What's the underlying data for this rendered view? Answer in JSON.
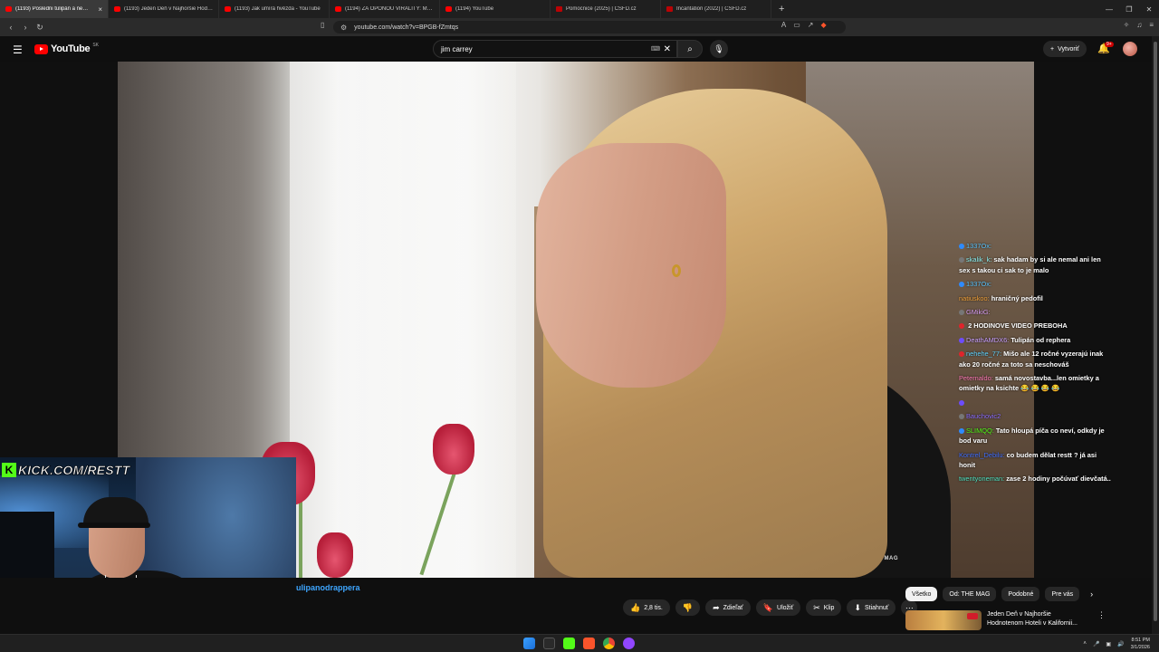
{
  "browser": {
    "tabs": [
      {
        "title": "(1193) Posledni tulipán a ne…",
        "active": true,
        "favicon": "youtube"
      },
      {
        "title": "(1193) Jeden Deň v Najhoršie Hodn…",
        "active": false,
        "favicon": "youtube"
      },
      {
        "title": "(1193) Jak umírá hvězda - YouTube",
        "active": false,
        "favicon": "youtube"
      },
      {
        "title": "(1194) ZA OPONOU VIRALITY: MELI…",
        "active": false,
        "favicon": "youtube"
      },
      {
        "title": "(1194) YouTube",
        "active": false,
        "favicon": "youtube"
      },
      {
        "title": "Pomocnice (2025) | ČSFD.cz",
        "active": false,
        "favicon": "csfd"
      },
      {
        "title": "Incantation (2022) | ČSFD.cz",
        "active": false,
        "favicon": "csfd"
      }
    ],
    "url": "youtube.com/watch?v=BPGB-fZmtqs",
    "badge_count": ""
  },
  "youtube": {
    "logo_text": "YouTube",
    "region": "SK",
    "search_value": "jim carrey",
    "create_label": "Vytvoriť",
    "notif_count": "9+"
  },
  "video": {
    "watermark": "MAG",
    "channel_title": "ulipanodrappera"
  },
  "chat": [
    {
      "user": "1337Ox:",
      "text": "",
      "user_color": "#58c4ff",
      "icon": "#2e8bff"
    },
    {
      "user": "skalik_k:",
      "text": "sak hadam by si ale nemal ani len sex s takou ci sak to je malo",
      "user_color": "#8ef2f2",
      "icon": "#777"
    },
    {
      "user": "1337Ox:",
      "text": "",
      "user_color": "#58c4ff",
      "icon": "#2e8bff"
    },
    {
      "user": "natiuskoo:",
      "text": "hraničný pedofil",
      "user_color": "#f2a23a",
      "icon": ""
    },
    {
      "user": "GMikiG:",
      "text": "",
      "user_color": "#d79cf2",
      "icon": "#777"
    },
    {
      "user": "",
      "text": "2 HODINOVE VIDEO PREBOHA",
      "user_color": "#e0242b",
      "icon": "#e0242b"
    },
    {
      "user": "DeathAMDX6:",
      "text": "Tulipán od rephera",
      "user_color": "#c9a0ff",
      "icon": "#6d4cff"
    },
    {
      "user": "nehehe_77:",
      "text": "Mišo ale 12 ročné vyzerajú inak ako 20 ročné za toto sa neschováš",
      "user_color": "#5fd3ff",
      "icon": "#e0242b"
    },
    {
      "user": "Peternaldo:",
      "text": "samá novostavba...len omietky a omietky na ksichte 😂 😂 😂 😂",
      "user_color": "#ff7ab6",
      "icon": ""
    },
    {
      "user": "",
      "text": "",
      "user_color": "#e0242b",
      "icon": "#6d4cff"
    },
    {
      "user": "Bauchovic2",
      "text": "",
      "user_color": "#8a6cff",
      "icon": "#777"
    },
    {
      "user": "SLIMQQ:",
      "text": "Tato hloupá píča co neví, odkdy je bod varu",
      "user_color": "#53fc18",
      "icon": "#2e8bff"
    },
    {
      "user": "Kontrel_Debilu:",
      "text": "co budem dělat restt ? já asi honit",
      "user_color": "#3e6dff",
      "icon": ""
    },
    {
      "user": "twentyoneman:",
      "text": "zase 2 hodiny počúvať dievčatá..",
      "user_color": "#4fe0c0",
      "icon": ""
    }
  ],
  "overlay": {
    "kick_url": "KICK.COM/RESTT"
  },
  "actions": {
    "like_count": "2,8 tis.",
    "share_label": "Zdieľať",
    "save_label": "Uložiť",
    "clip_label": "Klip",
    "download_label": "Stiahnuť"
  },
  "chips": [
    {
      "label": "Všetko",
      "selected": true
    },
    {
      "label": "Od: THE MAG",
      "selected": false
    },
    {
      "label": "Podobné",
      "selected": false
    },
    {
      "label": "Pre vás",
      "selected": false
    }
  ],
  "recommendation": {
    "title": "Jeden Deň v Najhoršie Hodnotenom Hoteli v Kalifornii..."
  },
  "taskbar": {
    "time": "8:51 PM",
    "date": "3/1/2026"
  },
  "colors": {
    "youtube_red": "#ff0000",
    "kick_green": "#53fc18",
    "link_blue": "#3ea6ff"
  }
}
